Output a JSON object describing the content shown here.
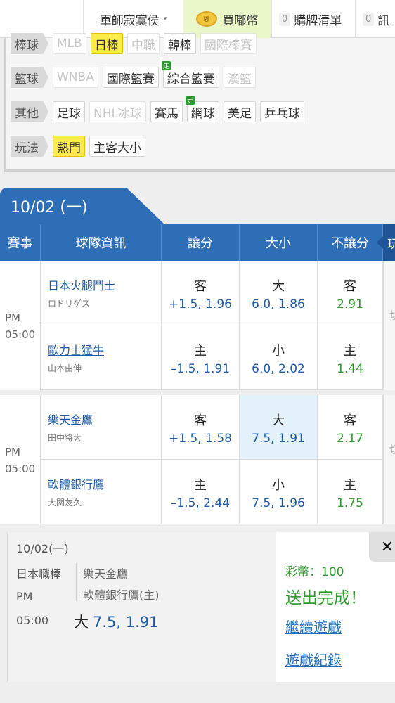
{
  "topbar": {
    "role": "軍師寂寞侯",
    "role_caret": "▾",
    "coin_icon_text": "嘟",
    "buy": "買嘟幣",
    "list_count": "0",
    "list": "購牌清單",
    "msg_count": "0",
    "msg": "訊"
  },
  "filters": {
    "baseball": {
      "label": "棒球",
      "chips": [
        "MLB",
        "日棒",
        "中職",
        "韓棒",
        "國際棒賽"
      ]
    },
    "basketball": {
      "label": "籃球",
      "chips": [
        "WNBA",
        "國際籃賽",
        "綜合籃賽",
        "澳籃"
      ]
    },
    "other": {
      "label": "其他",
      "chips": [
        "足球",
        "NHL冰球",
        "賽馬",
        "網球",
        "美足",
        "乒乓球"
      ]
    },
    "play": {
      "label": "玩法",
      "chips": [
        "熱門",
        "主客大小"
      ]
    },
    "live_mark": "走"
  },
  "date_tab": "10/02 (一)",
  "table_header": {
    "event": "賽事",
    "team_info": "球隊資訊",
    "handicap": "讓分",
    "total": "大小",
    "moneyline": "不讓分",
    "more": "玩"
  },
  "games": [
    {
      "ampm": "PM",
      "time": "05:00",
      "away": {
        "team": "日本火腿鬥士",
        "pitcher": "ロドリゲス",
        "hcp_side": "客",
        "hcp": "+1.5, 1.96",
        "ou_side": "大",
        "ou": "6.0, 1.86",
        "ml_side": "客",
        "ml": "2.91"
      },
      "home": {
        "team": "歐力士猛牛",
        "pitcher": "山本由伸",
        "hcp_side": "主",
        "hcp": "–1.5, 1.91",
        "ou_side": "小",
        "ou": "6.0, 2.02",
        "ml_side": "主",
        "ml": "1.44"
      },
      "side_cut": "切"
    },
    {
      "ampm": "PM",
      "time": "05:00",
      "away": {
        "team": "樂天金鷹",
        "pitcher": "田中将大",
        "hcp_side": "客",
        "hcp": "+1.5, 1.58",
        "ou_side": "大",
        "ou": "7.5, 1.91",
        "ml_side": "客",
        "ml": "2.17"
      },
      "home": {
        "team": "軟體銀行鷹",
        "pitcher": "大関友久",
        "hcp_side": "主",
        "hcp": "–1.5, 2.44",
        "ou_side": "小",
        "ou": "7.5, 1.96",
        "ml_side": "主",
        "ml": "1.75"
      },
      "side_cut": "切"
    }
  ],
  "ticket": {
    "date": "10/02(一)",
    "league": "日本職棒",
    "team1": "樂天金鷹",
    "team2": "軟體銀行鷹(主)",
    "ampm": "PM",
    "time": "05:00",
    "pick_side": "大",
    "pick_value": "7.5, 1.91",
    "coins": "彩幣：100",
    "done": "送出完成！",
    "continue": "繼續遊戲",
    "records": "遊戲紀錄",
    "close": "✕"
  }
}
